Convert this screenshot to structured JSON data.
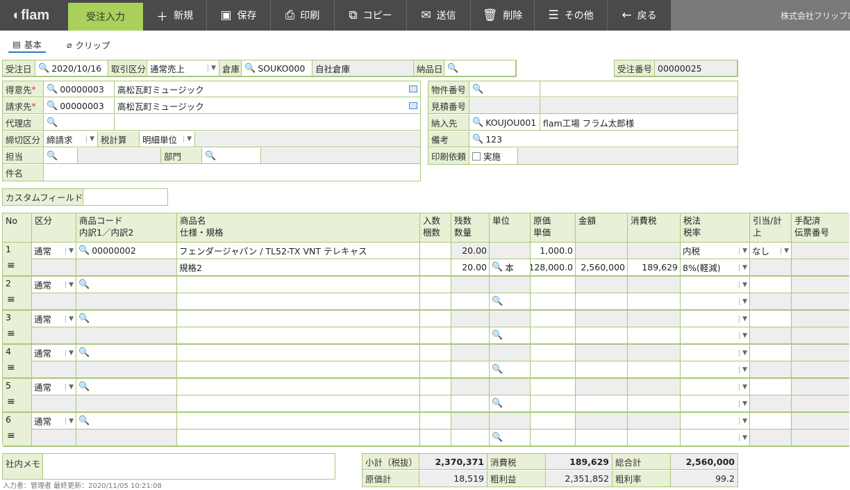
{
  "app": {
    "logo": "flam"
  },
  "toolbar": {
    "active_tab": "受注入力",
    "new": "新規",
    "save": "保存",
    "print": "印刷",
    "copy": "コピー",
    "send": "送信",
    "delete": "削除",
    "other": "その他",
    "back": "戻る",
    "company": "株式会社フリップロ"
  },
  "tabs": {
    "basic": "基本",
    "clip": "クリップ"
  },
  "header": {
    "order_date_label": "受注日",
    "order_date": "2020/10/16",
    "trade_type_label": "取引区分",
    "trade_type": "通常売上",
    "warehouse_label": "倉庫",
    "warehouse_code": "SOUKO000",
    "warehouse_name": "自社倉庫",
    "delivery_date_label": "納品日",
    "order_no_label": "受注番号",
    "order_no": "00000025"
  },
  "customer": {
    "customer_label": "得意先",
    "customer_code": "00000003",
    "customer_name": "高松瓦町ミュージック",
    "billing_label": "請求先",
    "billing_code": "00000003",
    "billing_name": "高松瓦町ミュージック",
    "agent_label": "代理店",
    "closing_label": "締切区分",
    "closing_value": "締請求",
    "tax_calc_label": "税計算",
    "tax_calc_value": "明細単位",
    "staff_label": "担当",
    "dept_label": "部門",
    "subject_label": "件名",
    "required_mark": "*"
  },
  "right": {
    "property_label": "物件番号",
    "estimate_label": "見積番号",
    "delivery_label": "納入先",
    "delivery_code": "KOUJOU001",
    "delivery_name": "flam工場 フラム太郎様",
    "remarks_label": "備考",
    "remarks_value": "123",
    "print_label": "印刷依頼",
    "print_value": "実施"
  },
  "custom": {
    "label": "カスタムフィールド"
  },
  "lines": {
    "headers": {
      "no": "No",
      "kubun": "区分",
      "code1": "商品コード",
      "code2": "内訳1／内訳2",
      "name1": "商品名",
      "name2": "仕様・規格",
      "irisu1": "入数",
      "irisu2": "梱数",
      "zan1": "残数",
      "zan2": "数量",
      "unit": "単位",
      "cost1": "原価",
      "cost2": "単価",
      "amount": "金額",
      "tax": "消費税",
      "taxmethod1": "税法",
      "taxmethod2": "税率",
      "hikiate": "引当/計上",
      "tehai1": "手配済",
      "tehai2": "伝票番号"
    },
    "rows": [
      {
        "no": "1",
        "kubun": "通常",
        "code": "00000002",
        "name": "フェンダージャパン / TL52-TX VNT テレキャス",
        "spec": "規格2",
        "zan": "20.00",
        "qty": "20.00",
        "unit": "本",
        "cost": "1,000.0",
        "price": "128,000.0",
        "amount": "2,560,000",
        "tax": "189,629",
        "taxmethod": "内税",
        "taxrate": "8%(軽減)",
        "hikiate": "なし"
      },
      {
        "no": "2",
        "kubun": "通常"
      },
      {
        "no": "3",
        "kubun": "通常"
      },
      {
        "no": "4",
        "kubun": "通常"
      },
      {
        "no": "5",
        "kubun": "通常"
      },
      {
        "no": "6",
        "kubun": "通常"
      }
    ]
  },
  "memo": {
    "label": "社内メモ"
  },
  "totals": {
    "subtotal_label": "小計（税抜）",
    "subtotal": "2,370,371",
    "tax_label": "消費税",
    "tax": "189,629",
    "total_label": "総合計",
    "total": "2,560,000",
    "cost_label": "原価計",
    "cost": "18,519",
    "profit_label": "粗利益",
    "profit": "2,351,852",
    "margin_label": "粗利率",
    "margin": "99.2"
  },
  "footer": {
    "text": "入力者：管理者 最終更新：2020/11/05 10:21:08"
  }
}
